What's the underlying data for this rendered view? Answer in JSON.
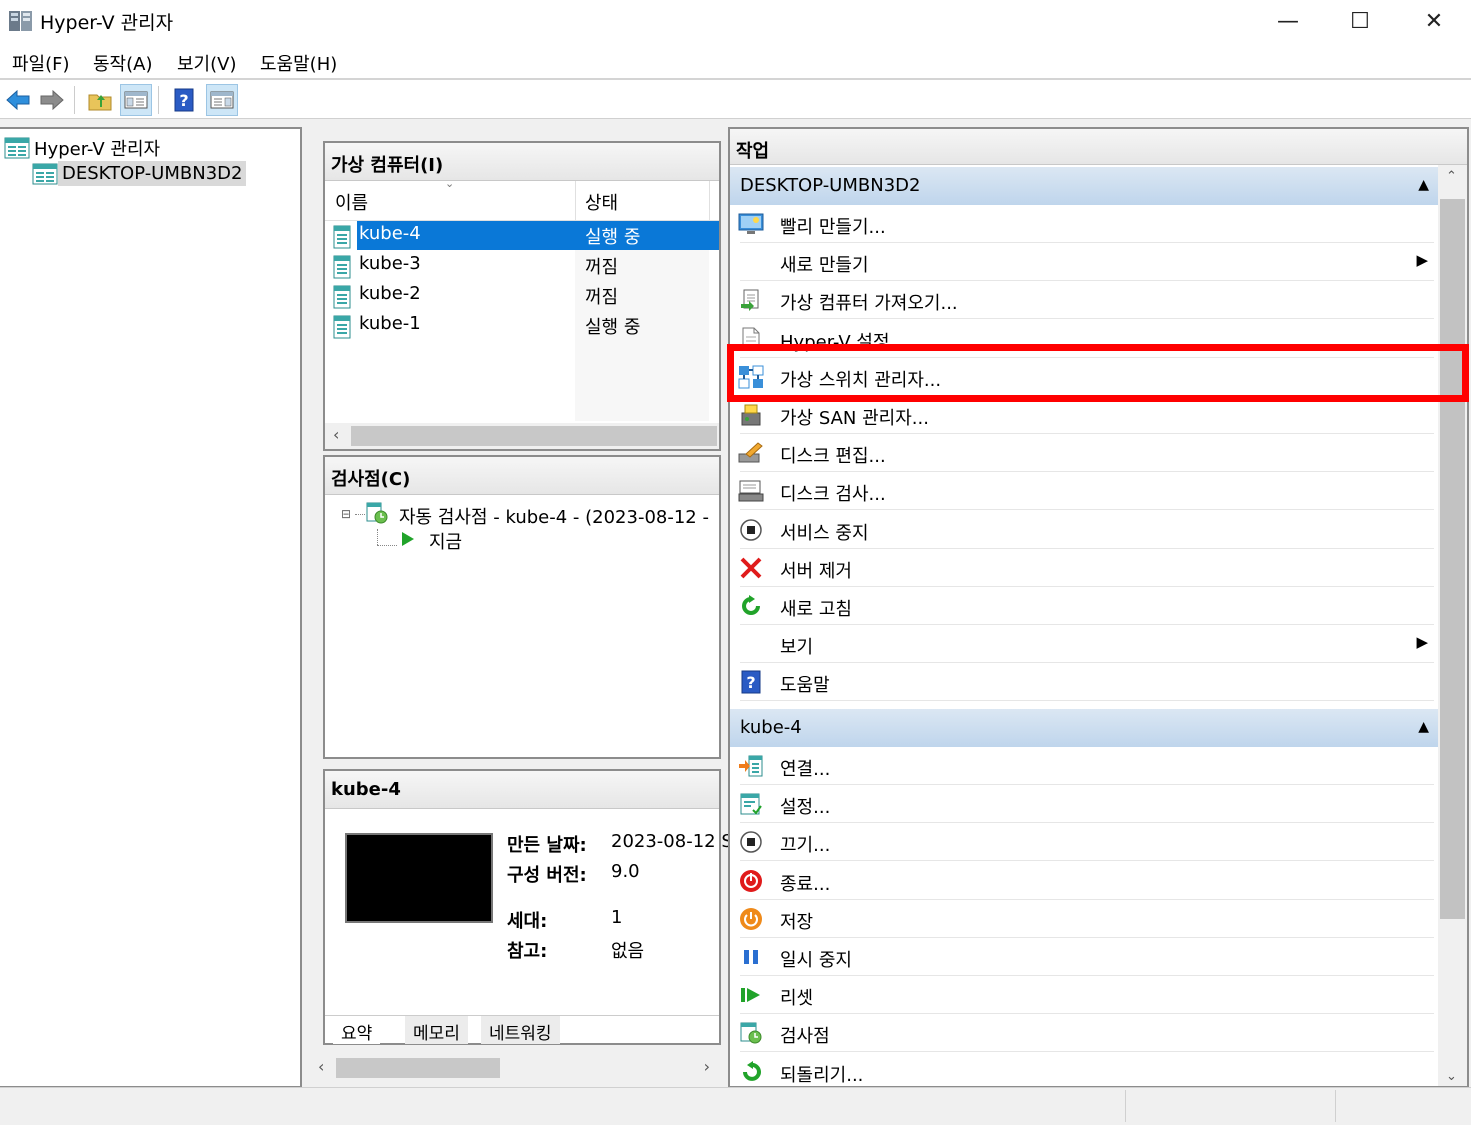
{
  "window": {
    "title": "Hyper-V 관리자",
    "controls": [
      "—",
      "☐",
      "✕"
    ]
  },
  "menu": [
    "파일(F)",
    "동작(A)",
    "보기(V)",
    "도움말(H)"
  ],
  "tree": {
    "root": "Hyper-V 관리자",
    "child": "DESKTOP-UMBN3D2"
  },
  "vm_panel": {
    "title": "가상 컴퓨터(I)",
    "columns": {
      "name": "이름",
      "state": "상태"
    },
    "rows": [
      {
        "name": "kube-4",
        "state": "실행 중"
      },
      {
        "name": "kube-3",
        "state": "꺼짐"
      },
      {
        "name": "kube-2",
        "state": "꺼짐"
      },
      {
        "name": "kube-1",
        "state": "실행 중"
      }
    ],
    "scroll_left": "‹"
  },
  "checkpoint_panel": {
    "title": "검사점(C)",
    "node": "자동 검사점 - kube-4 - (2023-08-12 -",
    "now": "지금"
  },
  "details_panel": {
    "title": "kube-4",
    "created_label": "만든 날짜:",
    "created_value": "2023-08-12 S",
    "config_label": "구성 버전:",
    "config_value": "9.0",
    "gen_label": "세대:",
    "gen_value": "1",
    "notes_label": "참고:",
    "notes_value": "없음",
    "tabs": [
      "요약",
      "메모리",
      "네트워킹"
    ],
    "scroll_left": "‹",
    "scroll_right": "›"
  },
  "actions": {
    "title": "작업",
    "server_section": "DESKTOP-UMBN3D2",
    "server_items": [
      {
        "label": "빨리 만들기...",
        "icon": "quick-create-icon"
      },
      {
        "label": "새로 만들기",
        "icon": "none",
        "submenu": true
      },
      {
        "label": "가상 컴퓨터 가져오기...",
        "icon": "import-vm-icon"
      },
      {
        "label": "Hyper-V 설정...",
        "icon": "settings-page-icon"
      },
      {
        "label": "가상 스위치 관리자...",
        "icon": "virtual-switch-icon"
      },
      {
        "label": "가상 SAN 관리자...",
        "icon": "san-icon"
      },
      {
        "label": "디스크 편집...",
        "icon": "edit-disk-icon"
      },
      {
        "label": "디스크 검사...",
        "icon": "inspect-disk-icon"
      },
      {
        "label": "서비스 중지",
        "icon": "stop-service-icon"
      },
      {
        "label": "서버 제거",
        "icon": "remove-server-icon"
      },
      {
        "label": "새로 고침",
        "icon": "refresh-icon"
      },
      {
        "label": "보기",
        "icon": "none",
        "submenu": true
      },
      {
        "label": "도움말",
        "icon": "help-icon"
      }
    ],
    "vm_section": "kube-4",
    "vm_items": [
      {
        "label": "연결...",
        "icon": "connect-icon"
      },
      {
        "label": "설정...",
        "icon": "vm-settings-icon"
      },
      {
        "label": "끄기...",
        "icon": "turn-off-icon"
      },
      {
        "label": "종료...",
        "icon": "shutdown-icon"
      },
      {
        "label": "저장",
        "icon": "save-icon"
      },
      {
        "label": "일시 중지",
        "icon": "pause-icon"
      },
      {
        "label": "리셋",
        "icon": "reset-icon"
      },
      {
        "label": "검사점",
        "icon": "checkpoint-icon"
      },
      {
        "label": "되돌리기...",
        "icon": "revert-icon"
      }
    ],
    "highlighted_item": "가상 스위치 관리자..."
  },
  "colors": {
    "selection": "#0a78d7",
    "section_header": "#c9dcef",
    "highlight_box": "#ff0000"
  }
}
